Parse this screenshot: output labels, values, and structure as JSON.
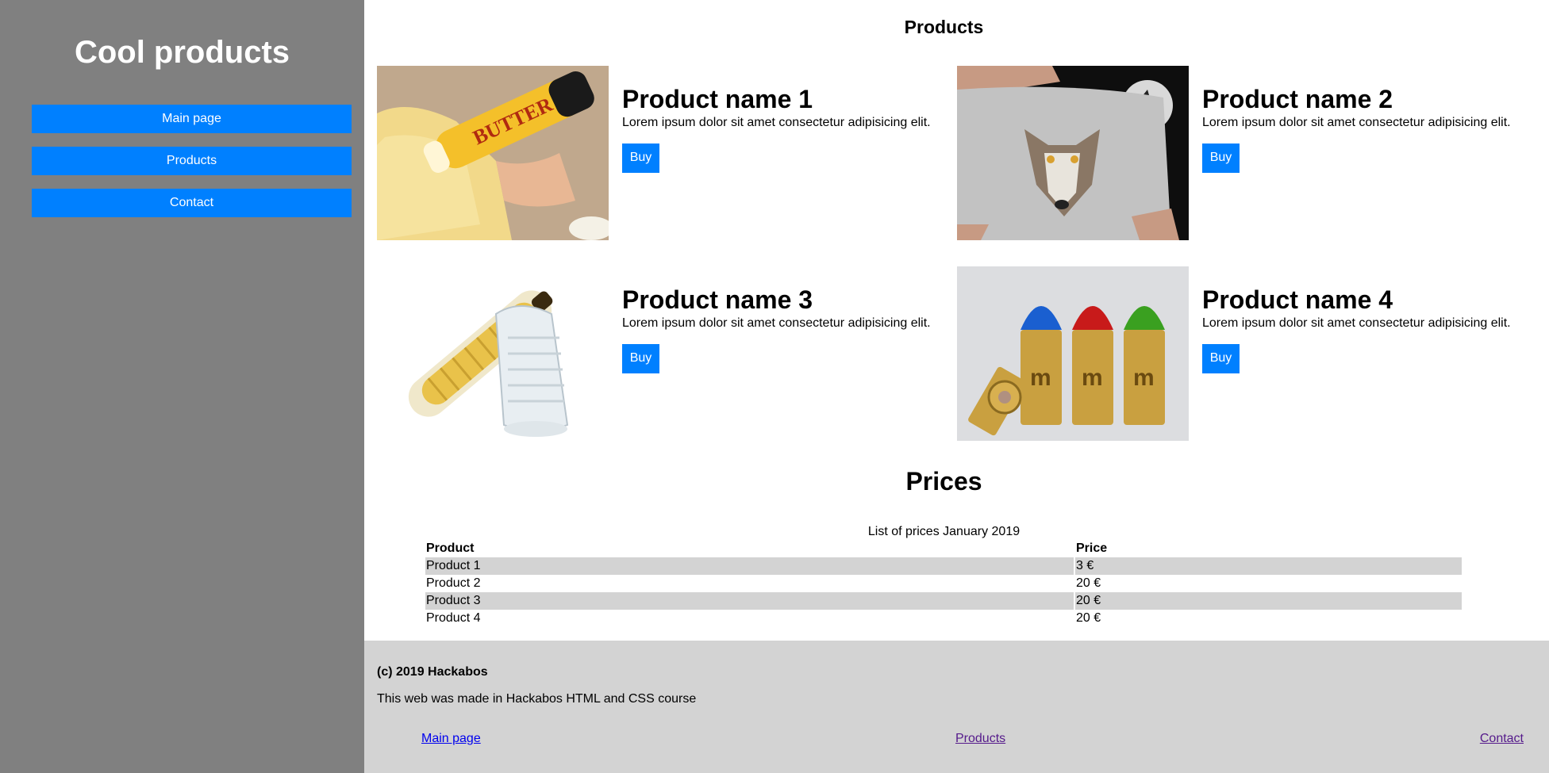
{
  "sidebar": {
    "title": "Cool products",
    "nav": [
      "Main page",
      "Products",
      "Contact"
    ]
  },
  "main": {
    "heading": "Products",
    "products": [
      {
        "name": "Product name 1",
        "description": "Lorem ipsum dolor sit amet consectetur adipisicing elit.",
        "buy_label": "Buy",
        "image": "butter-stick-image"
      },
      {
        "name": "Product name 2",
        "description": "Lorem ipsum dolor sit amet consectetur adipisicing elit.",
        "buy_label": "Buy",
        "image": "wolf-underwear-image"
      },
      {
        "name": "Product name 3",
        "description": "Lorem ipsum dolor sit amet consectetur adipisicing elit.",
        "buy_label": "Buy",
        "image": "banana-case-image"
      },
      {
        "name": "Product name 4",
        "description": "Lorem ipsum dolor sit amet consectetur adipisicing elit.",
        "buy_label": "Buy",
        "image": "candy-bullets-image"
      }
    ],
    "prices": {
      "heading": "Prices",
      "caption": "List of prices January 2019",
      "headers": [
        "Product",
        "Price"
      ],
      "rows": [
        [
          "Product 1",
          "3 €"
        ],
        [
          "Product 2",
          "20 €"
        ],
        [
          "Product 3",
          "20 €"
        ],
        [
          "Product 4",
          "20 €"
        ]
      ]
    }
  },
  "footer": {
    "copyright": "(c) 2019 Hackabos",
    "note": "This web was made in Hackabos HTML and CSS course",
    "links": [
      "Main page",
      "Products",
      "Contact"
    ]
  },
  "colors": {
    "sidebar_bg": "#808080",
    "button_blue": "#0080ff",
    "footer_bg": "#d3d3d3",
    "link": "#0000ee",
    "visited_link": "#551a8b"
  }
}
